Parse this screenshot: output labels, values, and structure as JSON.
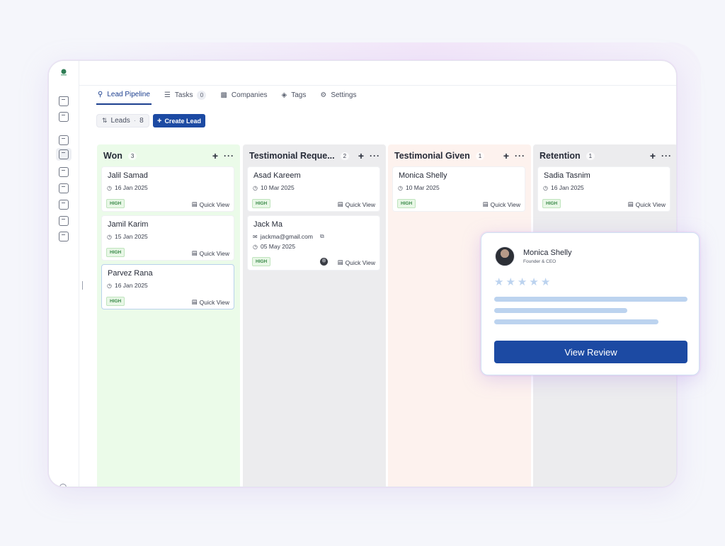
{
  "tabs": [
    {
      "label": "Lead Pipeline",
      "icon": "user-search-icon",
      "active": true
    },
    {
      "label": "Tasks",
      "icon": "checklist-icon",
      "count": "0"
    },
    {
      "label": "Companies",
      "icon": "building-icon"
    },
    {
      "label": "Tags",
      "icon": "tag-icon"
    },
    {
      "label": "Settings",
      "icon": "gear-icon"
    }
  ],
  "toolbar": {
    "leads_label": "Leads",
    "leads_count": "8",
    "create_label": "Create Lead"
  },
  "columns": [
    {
      "title": "Won",
      "count": "3",
      "color": "#ebfbe9",
      "cards": [
        {
          "name": "Jalil Samad",
          "date": "16 Jan 2025",
          "priority": "HIGH",
          "action": "Quick View"
        },
        {
          "name": "Jamil Karim",
          "date": "15 Jan 2025",
          "priority": "HIGH",
          "action": "Quick View"
        },
        {
          "name": "Parvez Rana",
          "date": "16 Jan 2025",
          "priority": "HIGH",
          "action": "Quick View"
        }
      ]
    },
    {
      "title": "Testimonial Reque...",
      "count": "2",
      "color": "#ececee",
      "cards": [
        {
          "name": "Asad Kareem",
          "date": "10 Mar 2025",
          "priority": "HIGH",
          "action": "Quick View"
        },
        {
          "name": "Jack Ma",
          "email": "jackma@gmail.com",
          "date": "05 May 2025",
          "priority": "HIGH",
          "action": "Quick View"
        }
      ]
    },
    {
      "title": "Testimonial Given",
      "count": "1",
      "color": "#fdf2ee",
      "cards": [
        {
          "name": "Monica Shelly",
          "date": "10 Mar 2025",
          "priority": "HIGH",
          "action": "Quick View"
        }
      ]
    },
    {
      "title": "Retention",
      "count": "1",
      "color": "#ececee",
      "cards": [
        {
          "name": "Sadia Tasnim",
          "date": "16 Jan 2025",
          "priority": "HIGH",
          "action": "Quick View"
        }
      ]
    }
  ],
  "review": {
    "name": "Monica Shelly",
    "role": "Founder & CEO",
    "stars": 5,
    "button_label": "View Review"
  },
  "colors": {
    "accent": "#1c4aa3",
    "badge_green": "#3a8a49",
    "star_placeholder": "#bcd3ef"
  }
}
